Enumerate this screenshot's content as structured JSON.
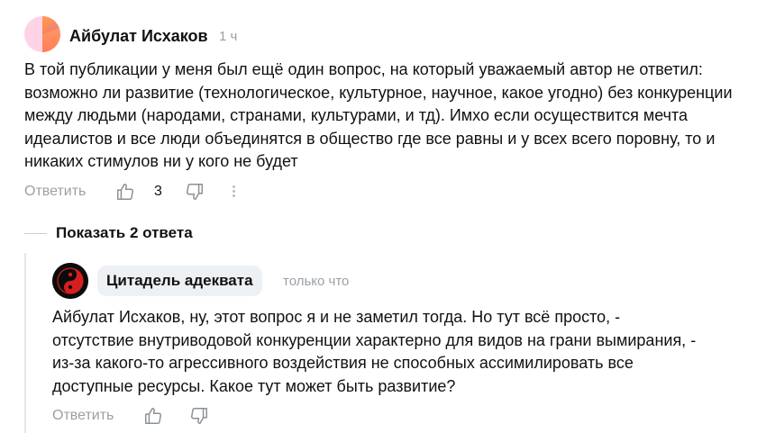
{
  "comment": {
    "author": "Айбулат Исхаков",
    "time": "1 ч",
    "text": "В той публикации у меня был ещё один вопрос, на который уважаемый автор не ответил: возможно ли развитие (технологическое, культурное, научное, какое угодно) без конкуренции между людьми (народами, странами, культурами, и тд). Имхо если осуществится мечта идеалистов и все люди объединятся в общество где все равны и у всех всего поровну, то и никаких стимулов ни у кого не будет",
    "reply_label": "Ответить",
    "likes": "3",
    "icons": {
      "like": "thumbs-up-icon",
      "dislike": "thumbs-down-icon",
      "more": "more-vertical-icon"
    }
  },
  "show_replies_label": "Показать 2 ответа",
  "reply": {
    "author": "Цитадель адеквата",
    "time": "только что",
    "text": "Айбулат Исхаков, ну, этот вопрос я и не заметил тогда. Но тут всё просто, - отсутствие внутриводовой конкуренции характерно для видов на грани вымирания, - из-за какого-то агрессивного воздействия не способных ассимилировать все доступные ресурсы. Какое тут может быть развитие?",
    "reply_label": "Ответить",
    "icons": {
      "like": "thumbs-up-icon",
      "dislike": "thumbs-down-icon"
    }
  },
  "colors": {
    "muted": "#9aa0a6",
    "pill_bg": "#eef1f4",
    "thread_line": "#e3e6e9"
  }
}
